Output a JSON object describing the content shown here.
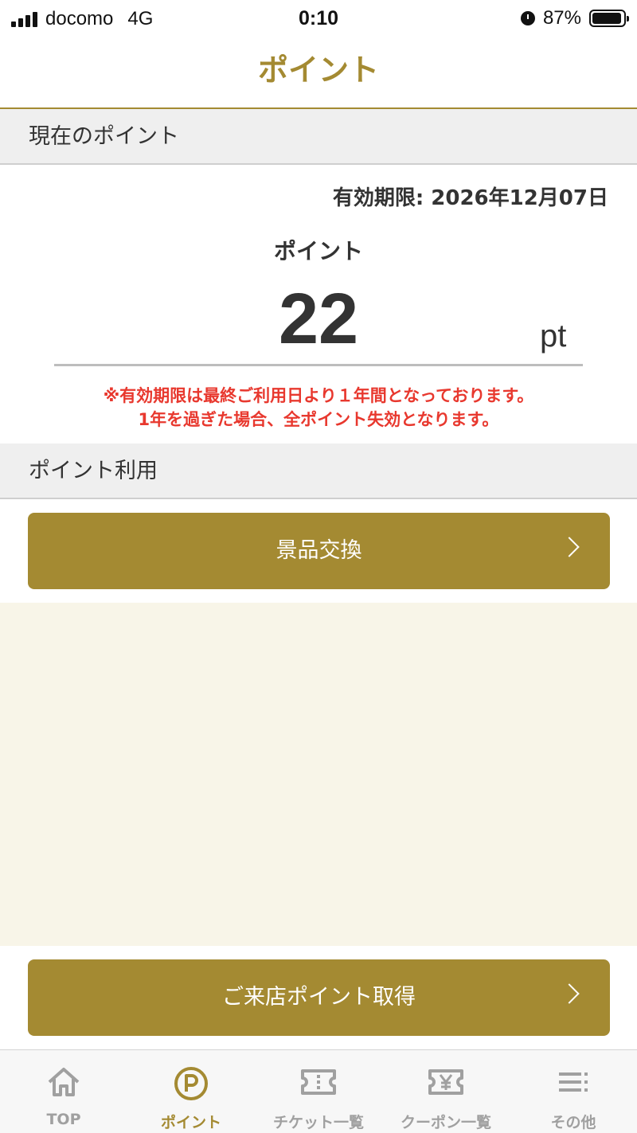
{
  "status_bar": {
    "carrier": "docomo",
    "network": "4G",
    "time": "0:10",
    "battery": "87%"
  },
  "header": {
    "title": "ポイント"
  },
  "current_points": {
    "section_title": "現在のポイント",
    "expiry": "有効期限: 2026年12月07日",
    "label": "ポイント",
    "value": "22",
    "unit": "pt",
    "warning_line1": "※有効期限は最終ご利用日より１年間となっております。",
    "warning_line2": "1年を過ぎた場合、全ポイント失効となります。"
  },
  "point_usage": {
    "section_title": "ポイント利用",
    "exchange_button": "景品交換"
  },
  "visit_button": "ご来店ポイント取得",
  "tabs": [
    {
      "label": "TOP",
      "icon": "home-icon"
    },
    {
      "label": "ポイント",
      "icon": "point-icon"
    },
    {
      "label": "チケット一覧",
      "icon": "ticket-icon"
    },
    {
      "label": "クーポン一覧",
      "icon": "coupon-icon"
    },
    {
      "label": "その他",
      "icon": "menu-icon"
    }
  ],
  "colors": {
    "accent": "#a48a32",
    "warning": "#e8382e",
    "cream": "#f8f5e8",
    "section_bg": "#efefef"
  }
}
